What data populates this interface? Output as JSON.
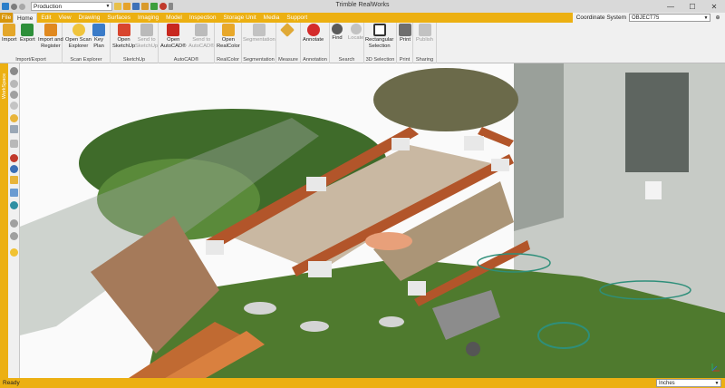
{
  "app": {
    "title": "Trimble RealWorks",
    "project": "Production"
  },
  "window": {
    "minimize": "—",
    "maximize": "☐",
    "close": "✕"
  },
  "menu": {
    "file": "File",
    "tabs": [
      "Home",
      "Edit",
      "View",
      "Drawing",
      "Surfaces",
      "Imaging",
      "Model",
      "Inspection",
      "Storage Unit",
      "Media",
      "Support"
    ]
  },
  "coordinate": {
    "label": "Coordinate System",
    "value": "OBJECT75",
    "extra": "⊕"
  },
  "ribbon": {
    "import": "Import",
    "export": "Export",
    "import_register": "Import and\nRegister",
    "open_scan_explorer": "Open Scan\nExplorer",
    "key_plan": "Key\nPlan",
    "open_sketchup": "Open\nSketchUp",
    "send_sketchup": "Send to\nSketchUp",
    "open_autocad": "Open\nAutoCAD®",
    "send_autocad": "Send to\nAutoCAD®",
    "open_realcolor": "Open\nRealColor",
    "segmentation": "Segmentation",
    "measure": "Measure",
    "annotate": "Annotate",
    "find": "Find",
    "locate": "Locate",
    "rect_selection": "Rectangular\nSelection",
    "print": "Print",
    "publish": "Publish",
    "groups": {
      "import_export": "Import/Export",
      "scan_explorer": "Scan Explorer",
      "sketchup": "SketchUp",
      "autocad": "AutoCAD®",
      "realcolor": "RealColor",
      "segmentation": "Segmentation",
      "measure": "Measure",
      "annotation": "Annotation",
      "search": "Search",
      "selection3d": "3D Selection",
      "print": "Print",
      "sharing": "Sharing"
    }
  },
  "sidebar": {
    "label": "WorkSpace"
  },
  "status": {
    "text": "Ready",
    "units": "Inches"
  },
  "colors": {
    "accent": "#ecb012",
    "ribbon": "#f0f0f0",
    "grass": "#4f7a2e",
    "wood": "#b2552a",
    "paver": "#c9b8a2",
    "wall": "#c7cbc6"
  }
}
